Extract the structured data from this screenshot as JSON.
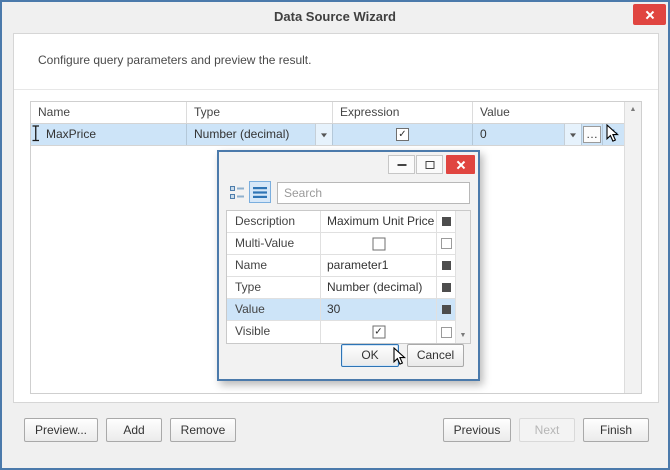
{
  "window": {
    "title": "Data Source Wizard",
    "subtitle": "Configure query parameters and preview the result."
  },
  "icons": {
    "check": "✓",
    "up_arrow": "▲",
    "down_arrow": "▼",
    "ellipsis": "…",
    "plus": "+"
  },
  "grid": {
    "columns": [
      "Name",
      "Type",
      "Expression",
      "Value"
    ],
    "rows": [
      {
        "name": "MaxPrice",
        "type": "Number (decimal)",
        "expression_checked": true,
        "value": "0"
      }
    ]
  },
  "popup": {
    "search_placeholder": "Search",
    "rows": [
      {
        "label": "Description",
        "value": "Maximum Unit Price"
      },
      {
        "label": "Multi-Value",
        "value": "",
        "checked": false
      },
      {
        "label": "Name",
        "value": "parameter1"
      },
      {
        "label": "Type",
        "value": "Number (decimal)"
      },
      {
        "label": "Value",
        "value": "30"
      },
      {
        "label": "Visible",
        "value": "",
        "checked": true
      }
    ],
    "buttons": {
      "ok": "OK",
      "cancel": "Cancel"
    }
  },
  "footer": {
    "preview": "Preview...",
    "add": "Add",
    "remove": "Remove",
    "previous": "Previous",
    "next": "Next",
    "finish": "Finish"
  },
  "colors": {
    "frame": "#4b7aab",
    "selection": "#cde4f8",
    "accent": "#2e74b5",
    "close_red": "#e04540"
  }
}
